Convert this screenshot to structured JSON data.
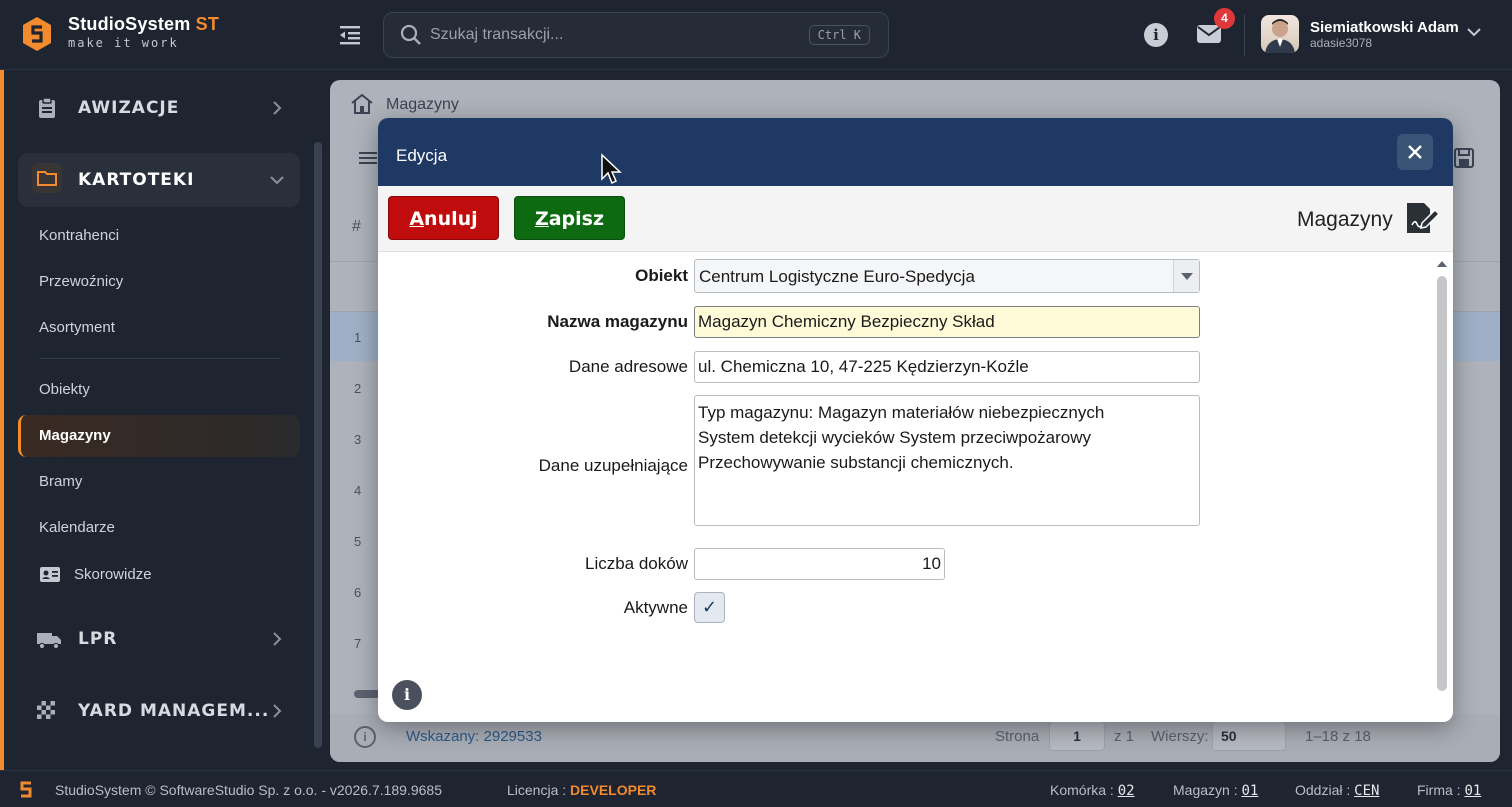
{
  "app": {
    "name": "StudioSystem",
    "name_suffix": "ST",
    "tagline": "make it work"
  },
  "search": {
    "placeholder": "Szukaj transakcji...",
    "shortcut": "Ctrl K"
  },
  "notifications": {
    "mail_count": "4"
  },
  "user": {
    "name": "Siemiatkowski Adam",
    "login": "adasie3078"
  },
  "sidebar": {
    "sections": [
      {
        "label": "AWIZACJE"
      },
      {
        "label": "KARTOTEKI"
      },
      {
        "label": "LPR"
      },
      {
        "label": "YARD MANAGEM..."
      }
    ],
    "items": [
      {
        "label": "Kontrahenci"
      },
      {
        "label": "Przewoźnicy"
      },
      {
        "label": "Asortyment"
      },
      {
        "label": "Obiekty"
      },
      {
        "label": "Magazyny"
      },
      {
        "label": "Bramy"
      },
      {
        "label": "Kalendarze"
      },
      {
        "label": "Skorowidze"
      }
    ]
  },
  "page": {
    "breadcrumb": "Magazyny",
    "grid_header_hash": "#",
    "row_numbers": [
      "1",
      "2",
      "3",
      "4",
      "5",
      "6",
      "7"
    ],
    "footer": {
      "selected": "Wskazany: 2929533",
      "page_label": "Strona",
      "page_value": "1",
      "page_of": "z 1",
      "rows_label": "Wierszy:",
      "rows_value": "50",
      "range": "1–18  z  18"
    }
  },
  "modal": {
    "title": "Edycja",
    "cancel_label": "Anuluj",
    "cancel_rest": "nuluj",
    "cancel_first": "A",
    "save_first": "Z",
    "save_rest": "apisz",
    "section_title": "Magazyny",
    "fields": {
      "obiekt_label": "Obiekt",
      "obiekt_value": "Centrum Logistyczne Euro-Spedycja",
      "nazwa_label": "Nazwa magazynu",
      "nazwa_value": "Magazyn Chemiczny Bezpieczny Skład",
      "adres_label": "Dane adresowe",
      "adres_value": "ul. Chemiczna 10, 47-225 Kędzierzyn-Koźle",
      "uzup_label": "Dane uzupełniające",
      "uzup_value": "Typ magazynu: Magazyn materiałów niebezpiecznych\nSystem detekcji wycieków System przeciwpożarowy\nPrzechowywanie substancji chemicznych.",
      "doki_label": "Liczba doków",
      "doki_value": "10",
      "aktywne_label": "Aktywne",
      "aktywne_checked": true
    }
  },
  "statusbar": {
    "copyright": "StudioSystem © SoftwareStudio Sp. z o.o. - v2026.7.189.9685",
    "licencja_label": "Licencja :",
    "licencja_value": "DEVELOPER",
    "komorka_label": "Komórka :",
    "komorka_value": "02",
    "magazyn_label": "Magazyn :",
    "magazyn_value": "01",
    "oddzial_label": "Oddział :",
    "oddzial_value": "CEN",
    "firma_label": "Firma :",
    "firma_value": "01"
  },
  "colors": {
    "accent": "#f28a2e",
    "modal_header": "#1e3a64",
    "cancel": "#c00c0c",
    "save": "#0d6a10",
    "highlight_field": "#fffbd9"
  }
}
